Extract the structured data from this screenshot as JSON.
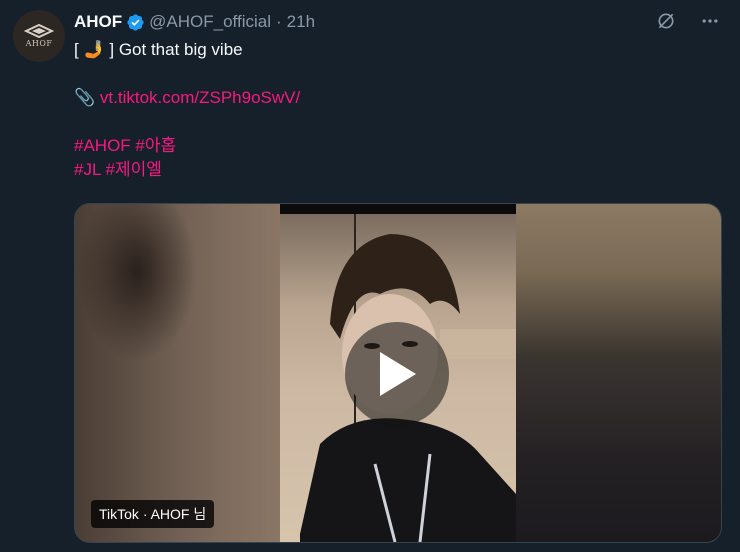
{
  "account": {
    "name": "AHOF",
    "handle": "@AHOF_official",
    "separator": "·",
    "time": "21h",
    "avatar_text": "AHOF"
  },
  "tweet": {
    "line1_prefix": "[",
    "line1_emoji": "🤳",
    "line1_suffix": "] Got that big vibe",
    "link_icon": "📎",
    "link": "vt.tiktok.com/ZSPh9oSwV/",
    "hashtags_line1": "#AHOF #아홉",
    "hashtags_line2": "#JL #제이엘"
  },
  "media": {
    "source_badge": "TikTok · AHOF 님"
  },
  "icons": {
    "grok": "grok-icon",
    "more": "more-icon",
    "verified": "verified-icon",
    "play": "play-icon"
  },
  "colors": {
    "background": "#15202b",
    "text": "#f7f9f9",
    "muted": "#8b98a5",
    "link": "#f91880",
    "verified": "#1d9bf0"
  }
}
